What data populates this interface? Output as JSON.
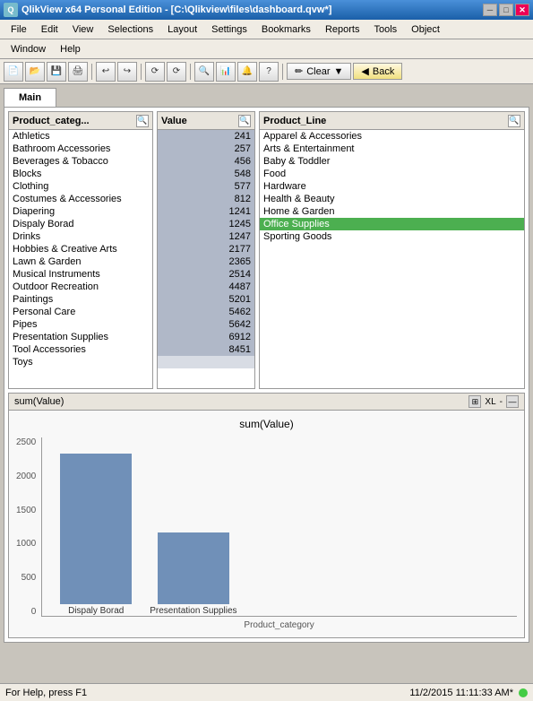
{
  "window": {
    "title": "QlikView x64 Personal Edition - [C:\\Qlikview\\files\\dashboard.qvw*]",
    "icon": "Q"
  },
  "menubar": {
    "items": [
      "File",
      "Edit",
      "View",
      "Selections",
      "Layout",
      "Settings",
      "Bookmarks",
      "Reports",
      "Tools",
      "Object",
      "Window",
      "Help"
    ]
  },
  "toolbar": {
    "clear_label": "Clear",
    "back_label": "Back"
  },
  "tabs": {
    "items": [
      {
        "label": "Main",
        "active": true
      }
    ]
  },
  "product_category": {
    "header": "Product_categ...",
    "items": [
      {
        "label": "Athletics",
        "state": "normal"
      },
      {
        "label": "Bathroom Accessories",
        "state": "normal"
      },
      {
        "label": "Beverages & Tobacco",
        "state": "normal"
      },
      {
        "label": "Blocks",
        "state": "normal"
      },
      {
        "label": "Clothing",
        "state": "normal"
      },
      {
        "label": "Costumes & Accessories",
        "state": "normal"
      },
      {
        "label": "Diapering",
        "state": "normal"
      },
      {
        "label": "Dispaly Borad",
        "state": "normal"
      },
      {
        "label": "Drinks",
        "state": "normal"
      },
      {
        "label": "Hobbies & Creative Arts",
        "state": "normal"
      },
      {
        "label": "Lawn & Garden",
        "state": "normal"
      },
      {
        "label": "Musical Instruments",
        "state": "normal"
      },
      {
        "label": "Outdoor Recreation",
        "state": "normal"
      },
      {
        "label": "Paintings",
        "state": "normal"
      },
      {
        "label": "Personal Care",
        "state": "normal"
      },
      {
        "label": "Pipes",
        "state": "normal"
      },
      {
        "label": "Presentation Supplies",
        "state": "normal"
      },
      {
        "label": "Tool Accessories",
        "state": "normal"
      },
      {
        "label": "Toys",
        "state": "normal"
      }
    ]
  },
  "value": {
    "header": "Value",
    "items": [
      {
        "value": "241"
      },
      {
        "value": "257"
      },
      {
        "value": "456"
      },
      {
        "value": "548"
      },
      {
        "value": "577"
      },
      {
        "value": "812"
      },
      {
        "value": "1241"
      },
      {
        "value": "1245"
      },
      {
        "value": "1247"
      },
      {
        "value": "2177"
      },
      {
        "value": "2365"
      },
      {
        "value": "2514"
      },
      {
        "value": "4487"
      },
      {
        "value": "5201"
      },
      {
        "value": "5462"
      },
      {
        "value": "5642"
      },
      {
        "value": "6912"
      },
      {
        "value": "8451"
      },
      {
        "value": ""
      }
    ]
  },
  "product_line": {
    "header": "Product_Line",
    "items": [
      {
        "label": "Apparel & Accessories",
        "state": "normal"
      },
      {
        "label": "Arts & Entertainment",
        "state": "normal"
      },
      {
        "label": "Baby & Toddler",
        "state": "normal"
      },
      {
        "label": "Food",
        "state": "normal"
      },
      {
        "label": "Hardware",
        "state": "normal"
      },
      {
        "label": "Health & Beauty",
        "state": "normal"
      },
      {
        "label": "Home & Garden",
        "state": "normal"
      },
      {
        "label": "Office Supplies",
        "state": "selected"
      },
      {
        "label": "Sporting Goods",
        "state": "normal"
      }
    ]
  },
  "chart": {
    "header": "sum(Value)",
    "title": "sum(Value)",
    "x_label": "Product_category",
    "y_axis": [
      "2500",
      "2000",
      "1500",
      "1000",
      "500",
      "0"
    ],
    "bars": [
      {
        "label": "Dispaly Borad",
        "height_pct": 82
      },
      {
        "label": "Presentation Supplies",
        "height_pct": 40
      }
    ]
  },
  "statusbar": {
    "help_text": "For Help, press F1",
    "datetime": "11/2/2015 11:11:33 AM*"
  }
}
